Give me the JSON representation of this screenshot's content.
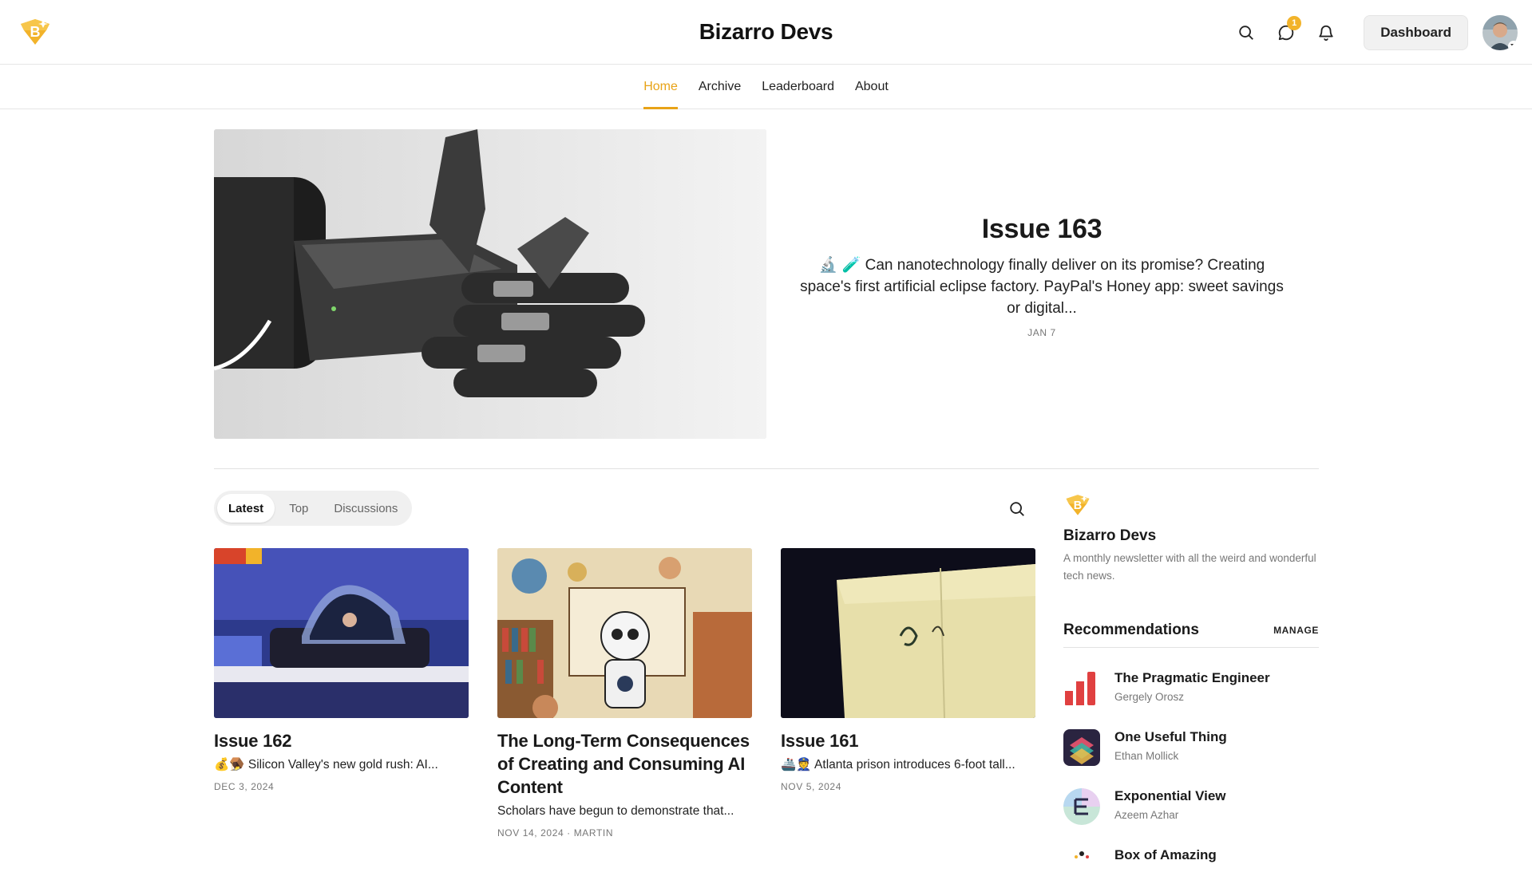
{
  "header": {
    "site_title": "Bizarro Devs",
    "logo_icon": "bizarro-logo-icon",
    "actions": {
      "search_icon": "search-icon",
      "chat_icon": "chat-bubble-icon",
      "chat_badge": "1",
      "bell_icon": "bell-icon",
      "dashboard_label": "Dashboard"
    },
    "accent": "#e8a317"
  },
  "nav": {
    "items": [
      {
        "label": "Home",
        "active": true
      },
      {
        "label": "Archive",
        "active": false
      },
      {
        "label": "Leaderboard",
        "active": false
      },
      {
        "label": "About",
        "active": false
      }
    ]
  },
  "hero": {
    "title": "Issue 163",
    "subtitle": "🔬 🧪 Can nanotechnology finally deliver on its promise? Creating space's first artificial eclipse factory. PayPal's Honey app: sweet savings or digital...",
    "date": "JAN 7"
  },
  "tabs": {
    "items": [
      "Latest",
      "Top",
      "Discussions"
    ],
    "active": "Latest"
  },
  "posts": [
    {
      "title": "Issue 162",
      "subtitle": "💰🪤 Silicon Valley's new gold rush: AI...",
      "meta": "DEC 3, 2024"
    },
    {
      "title": "The Long-Term Consequences of Creating and Consuming AI Content",
      "subtitle": "Scholars have begun to demonstrate that...",
      "meta": "NOV 14, 2024 · MARTIN"
    },
    {
      "title": "Issue 161",
      "subtitle": "🚢👮 Atlanta prison introduces 6-foot tall...",
      "meta": "NOV 5, 2024"
    }
  ],
  "sidebar": {
    "name": "Bizarro Devs",
    "description": "A monthly newsletter with all the weird and wonderful tech news.",
    "recommendations_title": "Recommendations",
    "manage_label": "MANAGE",
    "recommendations": [
      {
        "name": "The Pragmatic Engineer",
        "author": "Gergely Orosz"
      },
      {
        "name": "One Useful Thing",
        "author": "Ethan Mollick"
      },
      {
        "name": "Exponential View",
        "author": "Azeem Azhar"
      },
      {
        "name": "Box of Amazing",
        "author": ""
      }
    ]
  }
}
